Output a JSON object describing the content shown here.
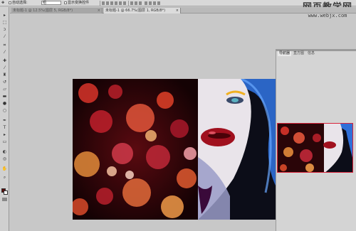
{
  "options_bar": {
    "auto_select_label": "自动选择:",
    "auto_select_value": "组",
    "show_transform_label": "显示变换控件"
  },
  "doc_tabs": [
    {
      "label": "未标题-1 @ 12.5%(图层 5, RGB/8*)",
      "close": "×"
    },
    {
      "label": "未标题-1 @ 66.7%(图层 1, RGB/8*)",
      "close": "×"
    }
  ],
  "panel_tabs": [
    {
      "label": "导航器"
    },
    {
      "label": "直方图"
    },
    {
      "label": "信息"
    }
  ],
  "watermark": {
    "main": "网页教学网",
    "sub": "www.webjx.com"
  },
  "toolbar": {
    "tools": [
      "move-tool",
      "marquee-tool",
      "lasso-tool",
      "quick-select-tool",
      "crop-tool",
      "eyedropper-tool",
      "healing-tool",
      "brush-tool",
      "clone-stamp-tool",
      "history-brush-tool",
      "eraser-tool",
      "gradient-tool",
      "blur-tool",
      "dodge-tool",
      "pen-tool",
      "type-tool",
      "path-select-tool",
      "shape-tool",
      "hand-tool",
      "zoom-tool"
    ],
    "foreground_color": "#5a0c0c",
    "background_color": "#ffffff"
  },
  "colors": {
    "accent_frame": "#d8233a",
    "lip_red": "#a0101e",
    "hair_blue": "#2f6fd8"
  }
}
